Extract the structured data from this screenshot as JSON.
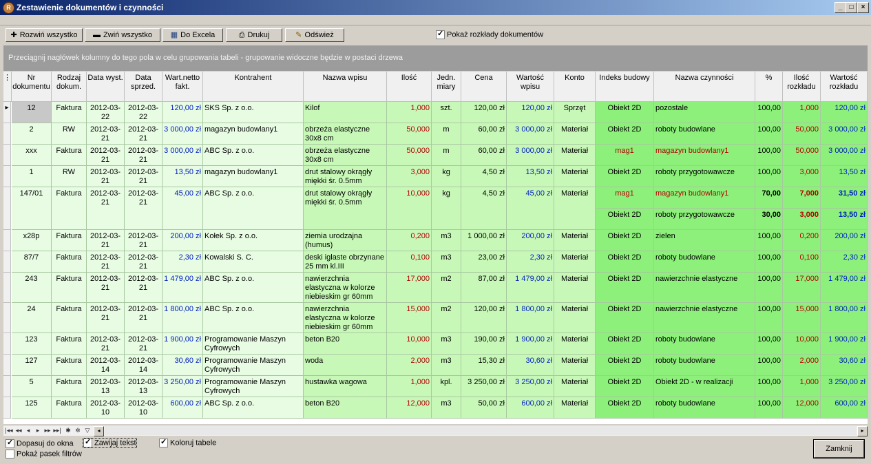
{
  "window": {
    "title": "Zestawienie dokumentów i czynności",
    "minimize": "_",
    "maximize": "□",
    "close": "×",
    "app_icon": "R"
  },
  "toolbar": {
    "expand_all": "Rozwiń wszystko",
    "collapse_all": "Zwiń wszystko",
    "to_excel": "Do Excela",
    "print": "Drukuj",
    "refresh": "Odśwież",
    "show_breakdowns": "Pokaż rozkłady dokumentów"
  },
  "group_hint": "Przeciągnij nagłówek kolumny do tego pola w celu grupowania tabeli - grupowanie widoczne będzie w postaci drzewa",
  "colors": {
    "doc_bg": "#e8fce4",
    "item_bg": "#c8f8b8",
    "activity_bg": "#8cf07a",
    "blue_value": "#0020c0",
    "red_value": "#b00000"
  },
  "columns": [
    "Nr dokumentu",
    "Rodzaj dokum.",
    "Data wyst.",
    "Data sprzed.",
    "Wart.netto fakt.",
    "Kontrahent",
    "Nazwa wpisu",
    "Ilość",
    "Jedn. miary",
    "Cena",
    "Wartość wpisu",
    "Konto",
    "Indeks budowy",
    "Nazwa czynności",
    "%",
    "Ilość rozkładu",
    "Wartość rozkładu"
  ],
  "rows": [
    {
      "nr": "12",
      "rodzaj": "Faktura",
      "data_wyst": "2012-03-22",
      "data_sprzed": "2012-03-22",
      "wart": "120,00 zł",
      "kontrahent": "SKS Sp. z o.o.",
      "nazwa": "Kilof",
      "ilosc": "1,000",
      "jedn": "szt.",
      "cena": "120,00 zł",
      "wartosc": "120,00 zł",
      "konto": "Sprzęt",
      "splits": [
        {
          "indeks": "Obiekt 2D",
          "czynnosc": "pozostale",
          "proc": "100,00",
          "il": "1,000",
          "wr": "120,00 zł"
        }
      ]
    },
    {
      "nr": "2",
      "rodzaj": "RW",
      "data_wyst": "2012-03-21",
      "data_sprzed": "2012-03-21",
      "wart": "3 000,00 zł",
      "kontrahent": "magazyn budowlany1",
      "nazwa": "obrzeża elastyczne 30x8 cm",
      "ilosc": "50,000",
      "jedn": "m",
      "cena": "60,00 zł",
      "wartosc": "3 000,00 zł",
      "konto": "Materiał",
      "splits": [
        {
          "indeks": "Obiekt 2D",
          "czynnosc": "roboty budowlane",
          "proc": "100,00",
          "il": "50,000",
          "wr": "3 000,00 zł"
        }
      ]
    },
    {
      "nr": "xxx",
      "rodzaj": "Faktura",
      "data_wyst": "2012-03-21",
      "data_sprzed": "2012-03-21",
      "wart": "3 000,00 zł",
      "kontrahent": "ABC Sp. z o.o.",
      "nazwa": "obrzeża elastyczne 30x8 cm",
      "ilosc": "50,000",
      "jedn": "m",
      "cena": "60,00 zł",
      "wartosc": "3 000,00 zł",
      "konto": "Materiał",
      "splits": [
        {
          "indeks": "mag1",
          "czynnosc": "magazyn budowlany1",
          "proc": "100,00",
          "il": "50,000",
          "wr": "3 000,00 zł",
          "red": true
        }
      ]
    },
    {
      "nr": "1",
      "rodzaj": "RW",
      "data_wyst": "2012-03-21",
      "data_sprzed": "2012-03-21",
      "wart": "13,50 zł",
      "kontrahent": "magazyn budowlany1",
      "nazwa": "drut stalowy okrągły miękki śr. 0.5mm",
      "ilosc": "3,000",
      "jedn": "kg",
      "cena": "4,50 zł",
      "wartosc": "13,50 zł",
      "konto": "Materiał",
      "splits": [
        {
          "indeks": "Obiekt 2D",
          "czynnosc": "roboty przygotowawcze",
          "proc": "100,00",
          "il": "3,000",
          "wr": "13,50 zł"
        }
      ]
    },
    {
      "nr": "147/01",
      "rodzaj": "Faktura",
      "data_wyst": "2012-03-21",
      "data_sprzed": "2012-03-21",
      "wart": "45,00 zł",
      "kontrahent": "ABC Sp. z o.o.",
      "nazwa": "drut stalowy okrągły miękki śr. 0.5mm",
      "ilosc": "10,000",
      "jedn": "kg",
      "cena": "4,50 zł",
      "wartosc": "45,00 zł",
      "konto": "Materiał",
      "splits": [
        {
          "indeks": "mag1",
          "czynnosc": "magazyn budowlany1",
          "proc": "70,00",
          "il": "7,000",
          "wr": "31,50 zł",
          "red": true,
          "bold": true
        },
        {
          "indeks": "Obiekt 2D",
          "czynnosc": "roboty przygotowawcze",
          "proc": "30,00",
          "il": "3,000",
          "wr": "13,50 zł",
          "bold": true
        }
      ]
    },
    {
      "nr": "x28p",
      "rodzaj": "Faktura",
      "data_wyst": "2012-03-21",
      "data_sprzed": "2012-03-21",
      "wart": "200,00 zł",
      "kontrahent": "Kołek Sp. z o.o.",
      "nazwa": "ziemia urodzajna (humus)",
      "ilosc": "0,200",
      "jedn": "m3",
      "cena": "1 000,00 zł",
      "wartosc": "200,00 zł",
      "konto": "Materiał",
      "splits": [
        {
          "indeks": "Obiekt 2D",
          "czynnosc": "zielen",
          "proc": "100,00",
          "il": "0,200",
          "wr": "200,00 zł"
        }
      ]
    },
    {
      "nr": "87/7",
      "rodzaj": "Faktura",
      "data_wyst": "2012-03-21",
      "data_sprzed": "2012-03-21",
      "wart": "2,30 zł",
      "kontrahent": "Kowalski S. C.",
      "nazwa": "deski iglaste obrzynane 25 mm kl.III",
      "ilosc": "0,100",
      "jedn": "m3",
      "cena": "23,00 zł",
      "wartosc": "2,30 zł",
      "konto": "Materiał",
      "splits": [
        {
          "indeks": "Obiekt 2D",
          "czynnosc": "roboty budowlane",
          "proc": "100,00",
          "il": "0,100",
          "wr": "2,30 zł"
        }
      ]
    },
    {
      "nr": "243",
      "rodzaj": "Faktura",
      "data_wyst": "2012-03-21",
      "data_sprzed": "2012-03-21",
      "wart": "1 479,00 zł",
      "kontrahent": "ABC Sp. z o.o.",
      "nazwa": "nawierzchnia elastyczna w kolorze niebieskim gr 60mm",
      "ilosc": "17,000",
      "jedn": "m2",
      "cena": "87,00 zł",
      "wartosc": "1 479,00 zł",
      "konto": "Materiał",
      "splits": [
        {
          "indeks": "Obiekt 2D",
          "czynnosc": "nawierzchnie elastyczne",
          "proc": "100,00",
          "il": "17,000",
          "wr": "1 479,00 zł"
        }
      ]
    },
    {
      "nr": "24",
      "rodzaj": "Faktura",
      "data_wyst": "2012-03-21",
      "data_sprzed": "2012-03-21",
      "wart": "1 800,00 zł",
      "kontrahent": "ABC Sp. z o.o.",
      "nazwa": "nawierzchnia elastyczna w kolorze niebieskim gr 60mm",
      "ilosc": "15,000",
      "jedn": "m2",
      "cena": "120,00 zł",
      "wartosc": "1 800,00 zł",
      "konto": "Materiał",
      "splits": [
        {
          "indeks": "Obiekt 2D",
          "czynnosc": "nawierzchnie elastyczne",
          "proc": "100,00",
          "il": "15,000",
          "wr": "1 800,00 zł"
        }
      ]
    },
    {
      "nr": "123",
      "rodzaj": "Faktura",
      "data_wyst": "2012-03-21",
      "data_sprzed": "2012-03-21",
      "wart": "1 900,00 zł",
      "kontrahent": "Programowanie Maszyn Cyfrowych",
      "nazwa": "beton B20",
      "ilosc": "10,000",
      "jedn": "m3",
      "cena": "190,00 zł",
      "wartosc": "1 900,00 zł",
      "konto": "Materiał",
      "splits": [
        {
          "indeks": "Obiekt 2D",
          "czynnosc": "roboty budowlane",
          "proc": "100,00",
          "il": "10,000",
          "wr": "1 900,00 zł"
        }
      ]
    },
    {
      "nr": "127",
      "rodzaj": "Faktura",
      "data_wyst": "2012-03-14",
      "data_sprzed": "2012-03-14",
      "wart": "30,60 zł",
      "kontrahent": "Programowanie Maszyn Cyfrowych",
      "nazwa": "woda",
      "ilosc": "2,000",
      "jedn": "m3",
      "cena": "15,30 zł",
      "wartosc": "30,60 zł",
      "konto": "Materiał",
      "splits": [
        {
          "indeks": "Obiekt 2D",
          "czynnosc": "roboty budowlane",
          "proc": "100,00",
          "il": "2,000",
          "wr": "30,60 zł"
        }
      ]
    },
    {
      "nr": "5",
      "rodzaj": "Faktura",
      "data_wyst": "2012-03-13",
      "data_sprzed": "2012-03-13",
      "wart": "3 250,00 zł",
      "kontrahent": "Programowanie Maszyn Cyfrowych",
      "nazwa": "hustawka wagowa",
      "ilosc": "1,000",
      "jedn": "kpl.",
      "cena": "3 250,00 zł",
      "wartosc": "3 250,00 zł",
      "konto": "Materiał",
      "splits": [
        {
          "indeks": "Obiekt 2D",
          "czynnosc": "Obiekt 2D - w realizacji",
          "proc": "100,00",
          "il": "1,000",
          "wr": "3 250,00 zł"
        }
      ]
    },
    {
      "nr": "125",
      "rodzaj": "Faktura",
      "data_wyst": "2012-03-10",
      "data_sprzed": "2012-03-10",
      "wart": "600,00 zł",
      "kontrahent": "ABC Sp. z o.o.",
      "nazwa": "beton B20",
      "ilosc": "12,000",
      "jedn": "m3",
      "cena": "50,00 zł",
      "wartosc": "600,00 zł",
      "konto": "Materiał",
      "splits": [
        {
          "indeks": "Obiekt 2D",
          "czynnosc": "roboty budowlane",
          "proc": "100,00",
          "il": "12,000",
          "wr": "600,00 zł"
        }
      ]
    }
  ],
  "bottom": {
    "fit_window": "Dopasuj do okna",
    "wrap_text": "Zawijaj tekst",
    "color_table": "Koloruj tabele",
    "show_filter": "Pokaż pasek filtrów",
    "close_button": "Zamknij"
  }
}
